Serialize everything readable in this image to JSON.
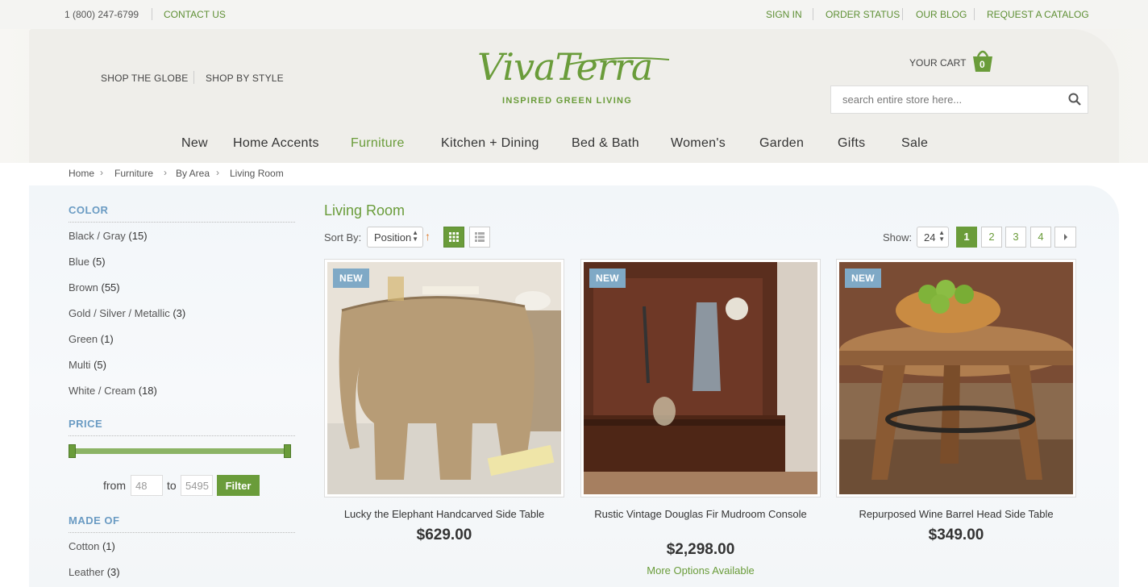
{
  "topbar": {
    "phone": "1 (800) 247-6799",
    "contact": "CONTACT US",
    "links": [
      "SIGN IN",
      "ORDER STATUS",
      "OUR BLOG",
      "REQUEST A CATALOG"
    ]
  },
  "header": {
    "shop_globe": "SHOP THE GLOBE",
    "shop_style": "SHOP BY STYLE",
    "logo": "VivaTerra",
    "tagline": "INSPIRED GREEN LIVING",
    "cart_label": "YOUR CART",
    "cart_count": "0",
    "search_placeholder": "search entire store here..."
  },
  "nav": [
    "New",
    "Home Accents",
    "Furniture",
    "Kitchen + Dining",
    "Bed & Bath",
    "Women's",
    "Garden",
    "Gifts",
    "Sale"
  ],
  "nav_active": "Furniture",
  "breadcrumb": [
    "Home",
    "Furniture",
    "By Area",
    "Living Room"
  ],
  "sidebar": {
    "color_title": "COLOR",
    "colors": [
      {
        "label": "Black / Gray",
        "count": "(15)"
      },
      {
        "label": "Blue",
        "count": "(5)"
      },
      {
        "label": "Brown",
        "count": "(55)"
      },
      {
        "label": "Gold / Silver / Metallic",
        "count": "(3)"
      },
      {
        "label": "Green",
        "count": "(1)"
      },
      {
        "label": "Multi",
        "count": "(5)"
      },
      {
        "label": "White / Cream",
        "count": "(18)"
      }
    ],
    "price_title": "PRICE",
    "from_label": "from",
    "to_label": "to",
    "price_from": "48",
    "price_to": "5495",
    "filter_label": "Filter",
    "made_title": "MADE OF",
    "materials": [
      {
        "label": "Cotton",
        "count": "(1)"
      },
      {
        "label": "Leather",
        "count": "(3)"
      }
    ]
  },
  "main": {
    "title": "Living Room",
    "sort_label": "Sort By:",
    "sort_value": "Position",
    "show_label": "Show:",
    "show_value": "24",
    "pages": [
      "1",
      "2",
      "3",
      "4"
    ],
    "current_page": "1"
  },
  "products": [
    {
      "badge": "NEW",
      "name": "Lucky the Elephant Handcarved Side Table",
      "price": "$629.00",
      "more": ""
    },
    {
      "badge": "NEW",
      "name": "Rustic Vintage Douglas Fir Mudroom Console",
      "price": "$2,298.00",
      "more": "More Options Available"
    },
    {
      "badge": "NEW",
      "name": "Repurposed Wine Barrel Head Side Table",
      "price": "$349.00",
      "more": ""
    }
  ],
  "colors": {
    "accent": "#6a9c3a",
    "section_title": "#6a9bc3",
    "badge": "#7fa9c6"
  }
}
